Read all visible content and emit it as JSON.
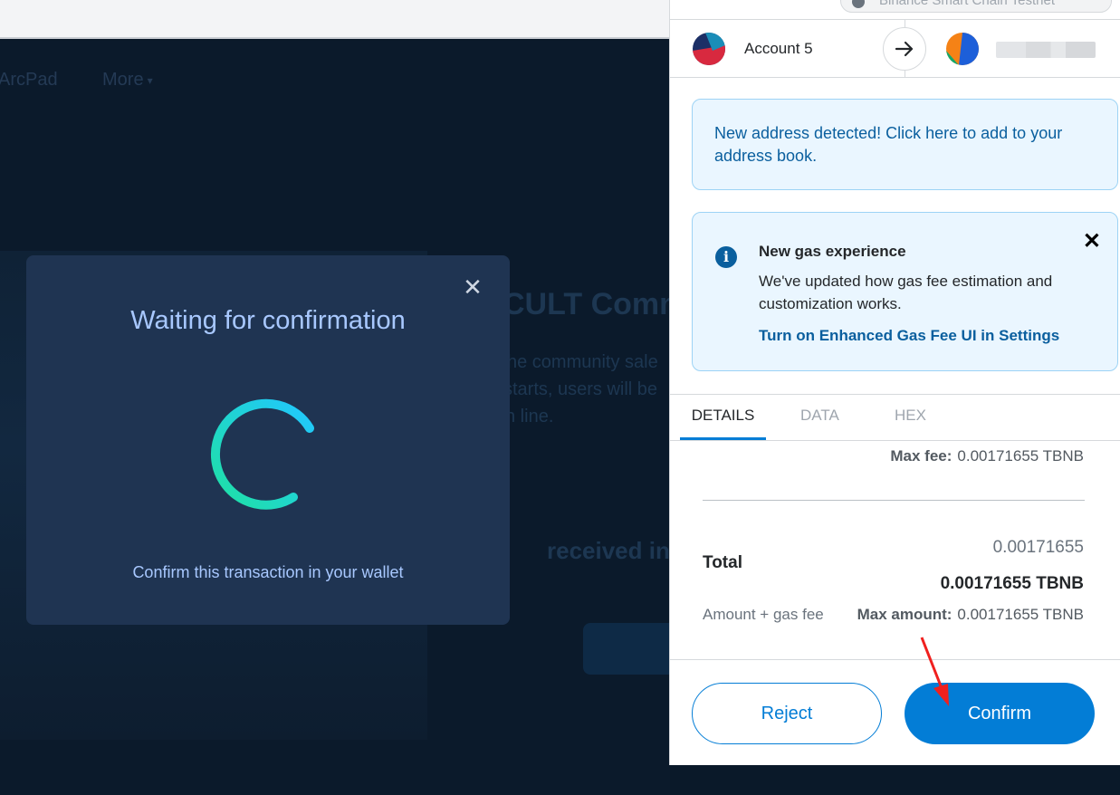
{
  "dapp": {
    "nav": {
      "arcpad": "ArcPad",
      "more": "More"
    },
    "title": "CULT Comm",
    "desc_lines": [
      "he community sale",
      "starts, users will be",
      "n line."
    ],
    "received": "received in"
  },
  "modal": {
    "title": "Waiting for confirmation",
    "message": "Confirm this transaction in your wallet",
    "spinner_colors": [
      "#1fe1a3",
      "#21c7ff"
    ]
  },
  "metamask": {
    "network": "Binance Smart Chain Testnet",
    "from_account": "Account 5",
    "new_address_notice": "New address detected! Click here to add to your address book.",
    "gas_notice": {
      "title": "New gas experience",
      "body": "We've updated how gas fee estimation and customization works.",
      "link": "Turn on Enhanced Gas Fee UI in Settings"
    },
    "tabs": [
      "DETAILS",
      "DATA",
      "HEX"
    ],
    "max_fee_label": "Max fee:",
    "max_fee_value": "0.00171655 TBNB",
    "total_label": "Total",
    "total_amount": "0.00171655",
    "total_amount_bold": "0.00171655 TBNB",
    "total_sub": "Amount + gas fee",
    "max_amount_label": "Max amount:",
    "max_amount_value": "0.00171655 TBNB",
    "reject_label": "Reject",
    "confirm_label": "Confirm",
    "colors": {
      "primary": "#037dd6",
      "info_bg": "#eaf6ff",
      "info_border": "#9dd3f5"
    }
  }
}
